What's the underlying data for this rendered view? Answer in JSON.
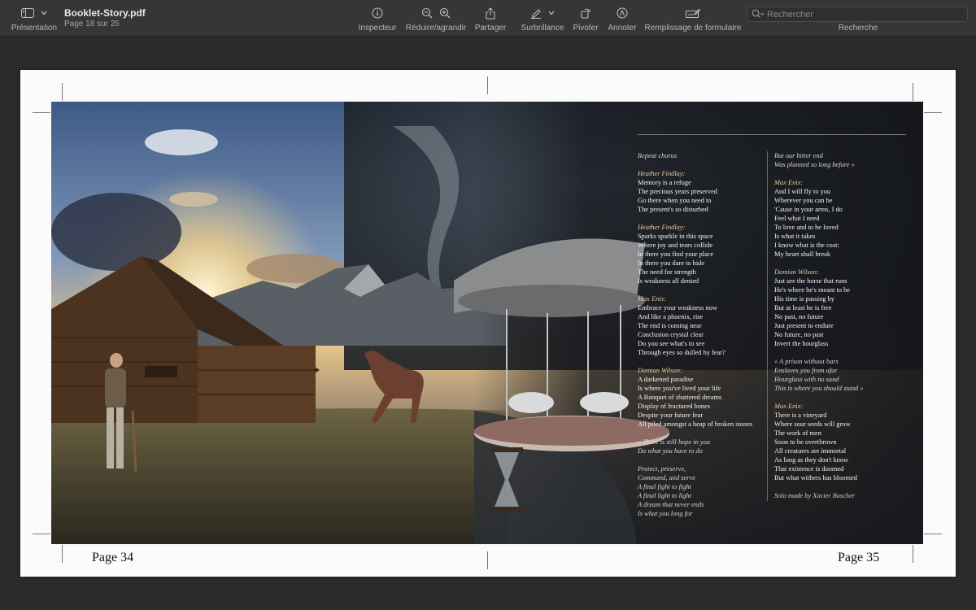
{
  "toolbar": {
    "view_label": "Présentation",
    "doc_title": "Booklet-Story.pdf",
    "doc_subtitle": "Page 18 sur 25",
    "inspector_label": "Inspecteur",
    "zoom_label": "Réduire/agrandir",
    "share_label": "Partager",
    "highlight_label": "Surbrillance",
    "rotate_label": "Pivoter",
    "annotate_label": "Annoter",
    "form_label": "Remplissage de formulaire",
    "search_placeholder": "Rechercher",
    "search_label": "Recherche"
  },
  "pages": {
    "left_number": "Page 34",
    "right_number": "Page 35"
  },
  "lyrics_left": [
    {
      "t": "Repeat chorus",
      "s": "it"
    },
    {
      "t": "",
      "s": "gap"
    },
    {
      "t": "Heather Findlay:",
      "s": "sp"
    },
    {
      "t": "Memory is a refuge",
      "s": "ln"
    },
    {
      "t": "The precious years preserved",
      "s": "ln"
    },
    {
      "t": "Go there when you need to",
      "s": "ln"
    },
    {
      "t": "The present's so disturbed",
      "s": "ln"
    },
    {
      "t": "",
      "s": "gap"
    },
    {
      "t": "Heather Findlay:",
      "s": "sp"
    },
    {
      "t": "Sparks sparkle in this space",
      "s": "ln"
    },
    {
      "t": "Where joy and tears collide",
      "s": "ln"
    },
    {
      "t": "In there you find your place",
      "s": "ln"
    },
    {
      "t": "In there you dare to hide",
      "s": "ln"
    },
    {
      "t": "The need for strength",
      "s": "ln"
    },
    {
      "t": "Is weakness all denied",
      "s": "ln"
    },
    {
      "t": "",
      "s": "gap"
    },
    {
      "t": "Max Enix:",
      "s": "sp"
    },
    {
      "t": "Embrace your weakness now",
      "s": "ln"
    },
    {
      "t": "And like a phoenix, rise",
      "s": "ln"
    },
    {
      "t": "The end is coming near",
      "s": "ln"
    },
    {
      "t": "Conclusion crystal clear",
      "s": "ln"
    },
    {
      "t": "Do you see what's to see",
      "s": "ln"
    },
    {
      "t": "Through eyes so dulled by fear?",
      "s": "ln"
    },
    {
      "t": "",
      "s": "gap"
    },
    {
      "t": "Damian Wilson:",
      "s": "sp"
    },
    {
      "t": "A darkened paradise",
      "s": "ln"
    },
    {
      "t": "Is where you've lived your life",
      "s": "ln"
    },
    {
      "t": "A Banquet of shattered dreams",
      "s": "ln"
    },
    {
      "t": "Display of fractured bones",
      "s": "ln"
    },
    {
      "t": "Despite your future fear",
      "s": "ln"
    },
    {
      "t": "All piled amongst a heap of broken stones",
      "s": "ln"
    },
    {
      "t": "",
      "s": "gap"
    },
    {
      "t": "« There is still hope in you",
      "s": "it"
    },
    {
      "t": "Do what you have to do",
      "s": "it"
    },
    {
      "t": "",
      "s": "gap"
    },
    {
      "t": "Protect, preserve,",
      "s": "it"
    },
    {
      "t": "Command, and serve",
      "s": "it"
    },
    {
      "t": "A final fight to fight",
      "s": "it"
    },
    {
      "t": "A final light to light",
      "s": "it"
    },
    {
      "t": "A dream that never ends",
      "s": "it"
    },
    {
      "t": "Is what you long for",
      "s": "it"
    }
  ],
  "lyrics_right": [
    {
      "t": "But our bitter end",
      "s": "it"
    },
    {
      "t": "Was planned so long before »",
      "s": "it"
    },
    {
      "t": "",
      "s": "gap"
    },
    {
      "t": "Max Enix:",
      "s": "sp"
    },
    {
      "t": "And I will fly to you",
      "s": "ln"
    },
    {
      "t": "Wherever you can be",
      "s": "ln"
    },
    {
      "t": "'Cause in your arms, I do",
      "s": "ln"
    },
    {
      "t": "Feel what I need",
      "s": "ln"
    },
    {
      "t": "To love and to be loved",
      "s": "ln"
    },
    {
      "t": "Is what it takes",
      "s": "ln"
    },
    {
      "t": "I know what is the cost:",
      "s": "ln"
    },
    {
      "t": "My heart shall break",
      "s": "ln"
    },
    {
      "t": "",
      "s": "gap"
    },
    {
      "t": "Damian Wilson:",
      "s": "sp"
    },
    {
      "t": "Just see the horse that runs",
      "s": "ln"
    },
    {
      "t": "He's where he's meant to be",
      "s": "ln"
    },
    {
      "t": "His time is passing by",
      "s": "ln"
    },
    {
      "t": "But at least he is free",
      "s": "ln"
    },
    {
      "t": "No past, no future",
      "s": "ln"
    },
    {
      "t": "Just present to endure",
      "s": "ln"
    },
    {
      "t": "No future, no past",
      "s": "ln"
    },
    {
      "t": "Invert the hourglass",
      "s": "ln"
    },
    {
      "t": "",
      "s": "gap"
    },
    {
      "t": "« A prison without bars",
      "s": "it"
    },
    {
      "t": "Enslaves you from afar",
      "s": "it"
    },
    {
      "t": "Hourglass with no sand",
      "s": "it"
    },
    {
      "t": "This is where you should stand »",
      "s": "it"
    },
    {
      "t": "",
      "s": "gap"
    },
    {
      "t": "Max Enix:",
      "s": "sp"
    },
    {
      "t": "There is a vineyard",
      "s": "ln"
    },
    {
      "t": "Where sour seeds will grow",
      "s": "ln"
    },
    {
      "t": "The work of men",
      "s": "ln"
    },
    {
      "t": "Soon to be overthrown",
      "s": "ln"
    },
    {
      "t": "All creatures are immortal",
      "s": "ln"
    },
    {
      "t": "As long as they don't know",
      "s": "ln"
    },
    {
      "t": "That existence is doomed",
      "s": "ln"
    },
    {
      "t": "But what withers has bloomed",
      "s": "ln"
    },
    {
      "t": "",
      "s": "gap"
    },
    {
      "t": "Solo made by Xavier Boscher",
      "s": "sp"
    }
  ]
}
